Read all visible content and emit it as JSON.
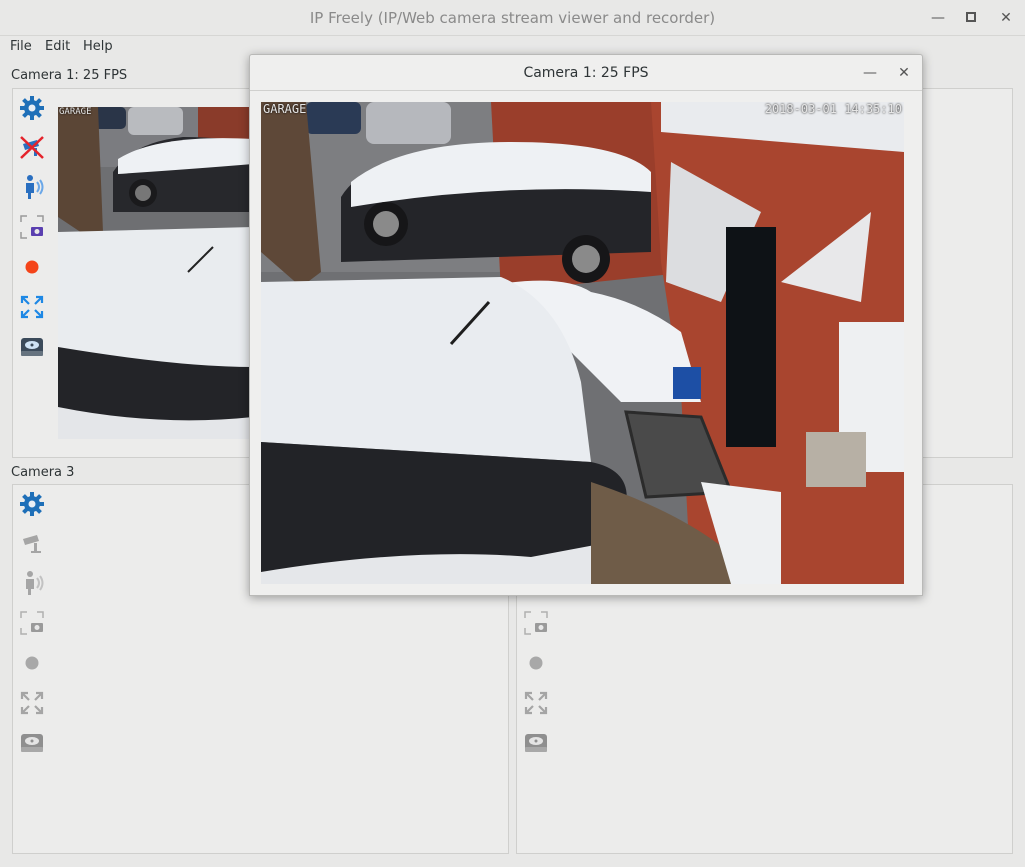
{
  "window": {
    "title": "IP Freely (IP/Web camera stream viewer and recorder)",
    "minimize_icon": "minimize-icon",
    "maximize_icon": "maximize-icon",
    "close_icon": "close-icon"
  },
  "menu": {
    "file": "File",
    "edit": "Edit",
    "help": "Help"
  },
  "cameras": {
    "cam1_label": "Camera 1: 25 FPS",
    "cam3_label": "Camera 3"
  },
  "toolbar_icons": [
    "settings-gear-icon",
    "camera-disabled-icon",
    "motion-person-icon",
    "snapshot-icon",
    "record-dot-icon",
    "fullscreen-expand-icon",
    "storage-drive-icon"
  ],
  "popup": {
    "title": "Camera 1: 25 FPS",
    "overlay_left": "GARAGE",
    "overlay_timestamp": "2018-03-01 14:35:10"
  },
  "colors": {
    "record_active": "#f44419",
    "record_inactive": "#9a9a9a",
    "accent_blue": "#1e88e5",
    "background": "#e8e8e7"
  }
}
